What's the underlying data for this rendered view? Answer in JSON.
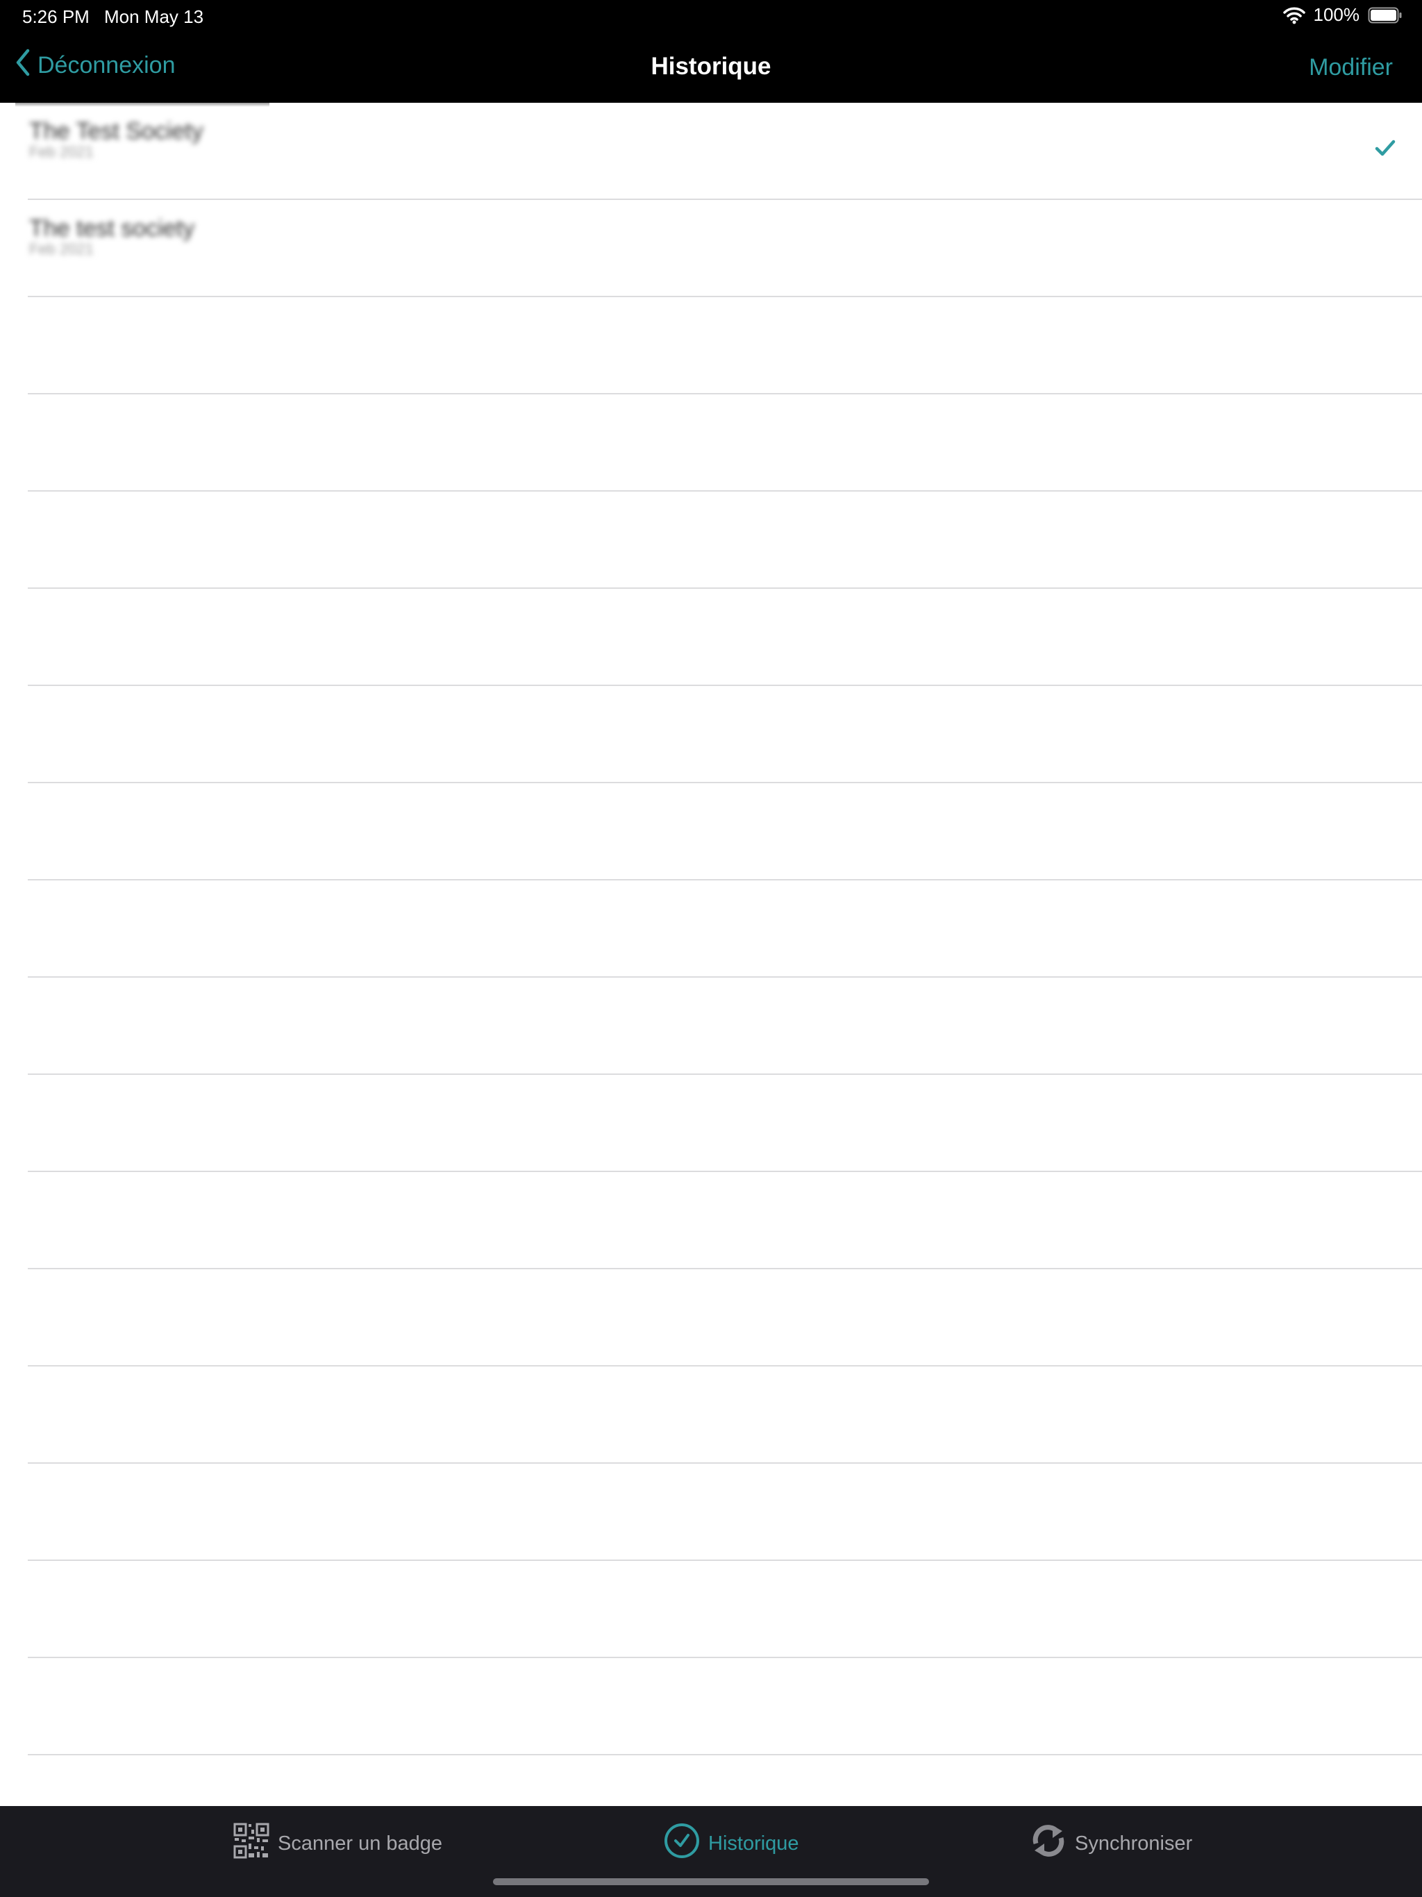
{
  "status_bar": {
    "time": "5:26 PM",
    "date": "Mon May 13",
    "battery": "100%"
  },
  "nav": {
    "back_label": "Déconnexion",
    "title": "Historique",
    "edit_label": "Modifier"
  },
  "rows": [
    {
      "title": "The Test Society",
      "subtitle": "Feb 2021",
      "checked": true
    },
    {
      "title": "The test society",
      "subtitle": "Feb 2021",
      "checked": false
    },
    {
      "title": "",
      "subtitle": "",
      "checked": false
    },
    {
      "title": "",
      "subtitle": "",
      "checked": false
    },
    {
      "title": "",
      "subtitle": "",
      "checked": false
    },
    {
      "title": "",
      "subtitle": "",
      "checked": false
    },
    {
      "title": "",
      "subtitle": "",
      "checked": false
    },
    {
      "title": "",
      "subtitle": "",
      "checked": false
    },
    {
      "title": "",
      "subtitle": "",
      "checked": false
    },
    {
      "title": "",
      "subtitle": "",
      "checked": false
    },
    {
      "title": "",
      "subtitle": "",
      "checked": false
    },
    {
      "title": "",
      "subtitle": "",
      "checked": false
    },
    {
      "title": "",
      "subtitle": "",
      "checked": false
    },
    {
      "title": "",
      "subtitle": "",
      "checked": false
    },
    {
      "title": "",
      "subtitle": "",
      "checked": false
    },
    {
      "title": "",
      "subtitle": "",
      "checked": false
    },
    {
      "title": "",
      "subtitle": "",
      "checked": false
    }
  ],
  "tabs": [
    {
      "label": "Scanner un badge",
      "icon": "qr-code-icon",
      "active": false
    },
    {
      "label": "Historique",
      "icon": "check-circle-icon",
      "active": true
    },
    {
      "label": "Synchroniser",
      "icon": "sync-icon",
      "active": false
    }
  ],
  "colors": {
    "accent": "#2f9ca2",
    "bar_background": "#000000",
    "tab_bar_background": "#1a1a1f",
    "separator": "#dcdcde",
    "inactive_tab": "#a8a8ad"
  }
}
